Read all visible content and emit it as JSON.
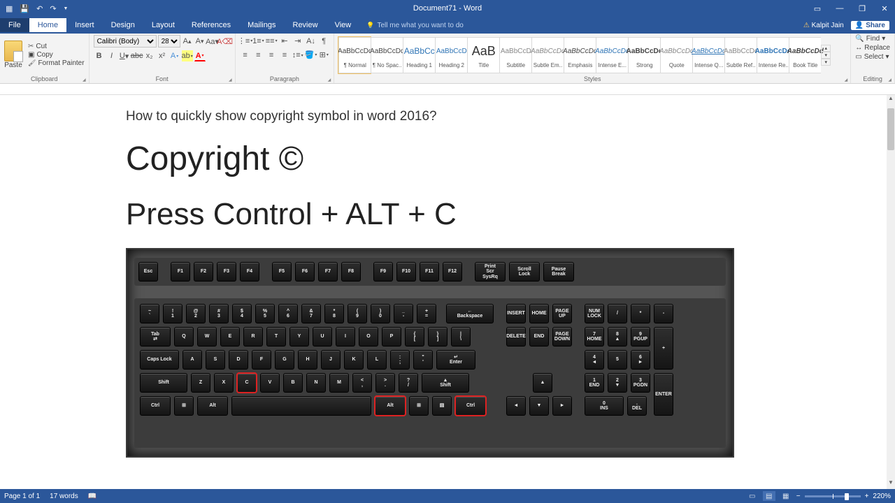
{
  "titlebar": {
    "title": "Document71 - Word"
  },
  "qat": {
    "undo": "↶",
    "redo": "↷"
  },
  "ribbon": {
    "tabs": [
      "File",
      "Home",
      "Insert",
      "Design",
      "Layout",
      "References",
      "Mailings",
      "Review",
      "View"
    ],
    "tellme": "Tell me what you want to do",
    "user": "Kalpit Jain",
    "share": "Share",
    "clipboard": {
      "paste": "Paste",
      "cut": "Cut",
      "copy": "Copy",
      "fp": "Format Painter",
      "label": "Clipboard"
    },
    "font": {
      "name": "Calibri (Body)",
      "size": "28",
      "label": "Font"
    },
    "paragraph": {
      "label": "Paragraph"
    },
    "styles_label": "Styles",
    "styles": [
      {
        "preview": "AaBbCcDd",
        "name": "¶ Normal",
        "color": "#444",
        "border": true
      },
      {
        "preview": "AaBbCcDd",
        "name": "¶ No Spac...",
        "color": "#444"
      },
      {
        "preview": "AaBbCc",
        "name": "Heading 1",
        "color": "#2e74b5",
        "size": "12"
      },
      {
        "preview": "AaBbCcD",
        "name": "Heading 2",
        "color": "#2e74b5"
      },
      {
        "preview": "AaB",
        "name": "Title",
        "color": "#333",
        "size": "18"
      },
      {
        "preview": "AaBbCcD",
        "name": "Subtitle",
        "color": "#888"
      },
      {
        "preview": "AaBbCcDd",
        "name": "Subtle Em...",
        "color": "#888",
        "italic": true
      },
      {
        "preview": "AaBbCcDd",
        "name": "Emphasis",
        "color": "#444",
        "italic": true
      },
      {
        "preview": "AaBbCcDd",
        "name": "Intense E...",
        "color": "#2e74b5",
        "italic": true
      },
      {
        "preview": "AaBbCcDd",
        "name": "Strong",
        "color": "#444",
        "bold": true
      },
      {
        "preview": "AaBbCcDd",
        "name": "Quote",
        "color": "#888",
        "italic": true
      },
      {
        "preview": "AaBbCcDd",
        "name": "Intense Q...",
        "color": "#2e74b5",
        "italic": true,
        "underline": true
      },
      {
        "preview": "AaBbCcDd",
        "name": "Subtle Ref...",
        "color": "#888"
      },
      {
        "preview": "AaBbCcDd",
        "name": "Intense Re...",
        "color": "#2e74b5",
        "bold": true
      },
      {
        "preview": "AaBbCcDd",
        "name": "Book Title",
        "color": "#444",
        "italic": true,
        "bold": true
      }
    ],
    "editing": {
      "find": "Find",
      "replace": "Replace",
      "select": "Select",
      "label": "Editing"
    }
  },
  "document": {
    "line1": "How to quickly show copyright symbol in word 2016?",
    "line2": "Copyright ©",
    "line3": "Press Control + ALT + C"
  },
  "status": {
    "page": "Page 1 of 1",
    "words": "17 words",
    "zoom": "220%"
  },
  "keyboard": {
    "row0": [
      "Esc"
    ],
    "frow1": [
      "F1",
      "F2",
      "F3",
      "F4"
    ],
    "frow2": [
      "F5",
      "F6",
      "F7",
      "F8"
    ],
    "frow3": [
      "F9",
      "F10",
      "F11",
      "F12"
    ],
    "fsys": [
      [
        "Print",
        "Scr",
        "SysRq"
      ],
      [
        "Scroll",
        "Lock"
      ],
      [
        "Pause",
        "Break"
      ]
    ],
    "row1": [
      [
        "~",
        "`"
      ],
      [
        "!",
        "1"
      ],
      [
        "@",
        "2"
      ],
      [
        "#",
        "3"
      ],
      [
        "$",
        "4"
      ],
      [
        "%",
        "5"
      ],
      [
        "^",
        "6"
      ],
      [
        "&",
        "7"
      ],
      [
        "*",
        "8"
      ],
      [
        "(",
        "9"
      ],
      [
        ")",
        "0"
      ],
      [
        "_",
        "-"
      ],
      [
        "+",
        "="
      ]
    ],
    "backspace": "Backspace",
    "tab": "Tab",
    "row2": [
      "Q",
      "W",
      "E",
      "R",
      "T",
      "Y",
      "U",
      "I",
      "O",
      "P",
      [
        "{",
        "["
      ],
      [
        "}",
        "]"
      ],
      [
        "|",
        "\\"
      ]
    ],
    "caps": "Caps Lock",
    "row3": [
      "A",
      "S",
      "D",
      "F",
      "G",
      "H",
      "J",
      "K",
      "L",
      [
        ":",
        ";"
      ],
      [
        "\"",
        "'"
      ]
    ],
    "enter": "Enter",
    "shift": "Shift",
    "row4": [
      "Z",
      "X",
      "C",
      "V",
      "B",
      "N",
      "M",
      [
        "<",
        ","
      ],
      [
        ">",
        "."
      ],
      [
        "?",
        "/"
      ]
    ],
    "ctrl": "Ctrl",
    "alt": "Alt",
    "win": "⊞",
    "menu": "▤",
    "nav1": [
      "INSERT",
      "HOME",
      "PAGE UP"
    ],
    "nav2": [
      "DELETE",
      "END",
      "PAGE DOWN"
    ],
    "up": "▲",
    "left": "◄",
    "down": "▼",
    "right": "►",
    "num_top": [
      "NUM LOCK",
      "/",
      "*",
      "-"
    ],
    "num1": [
      [
        "7",
        "HOME"
      ],
      [
        "8",
        "▲"
      ],
      [
        "9",
        "PGUP"
      ]
    ],
    "num2": [
      [
        "4",
        "◄"
      ],
      [
        "5",
        ""
      ],
      [
        "6",
        "►"
      ]
    ],
    "num3": [
      [
        "1",
        "END"
      ],
      [
        "2",
        "▼"
      ],
      [
        "3",
        "PGDN"
      ]
    ],
    "num0": [
      "0",
      "INS"
    ],
    "numdot": [
      ".",
      "DEL"
    ],
    "plus": "+",
    "enter2": "ENTER"
  }
}
